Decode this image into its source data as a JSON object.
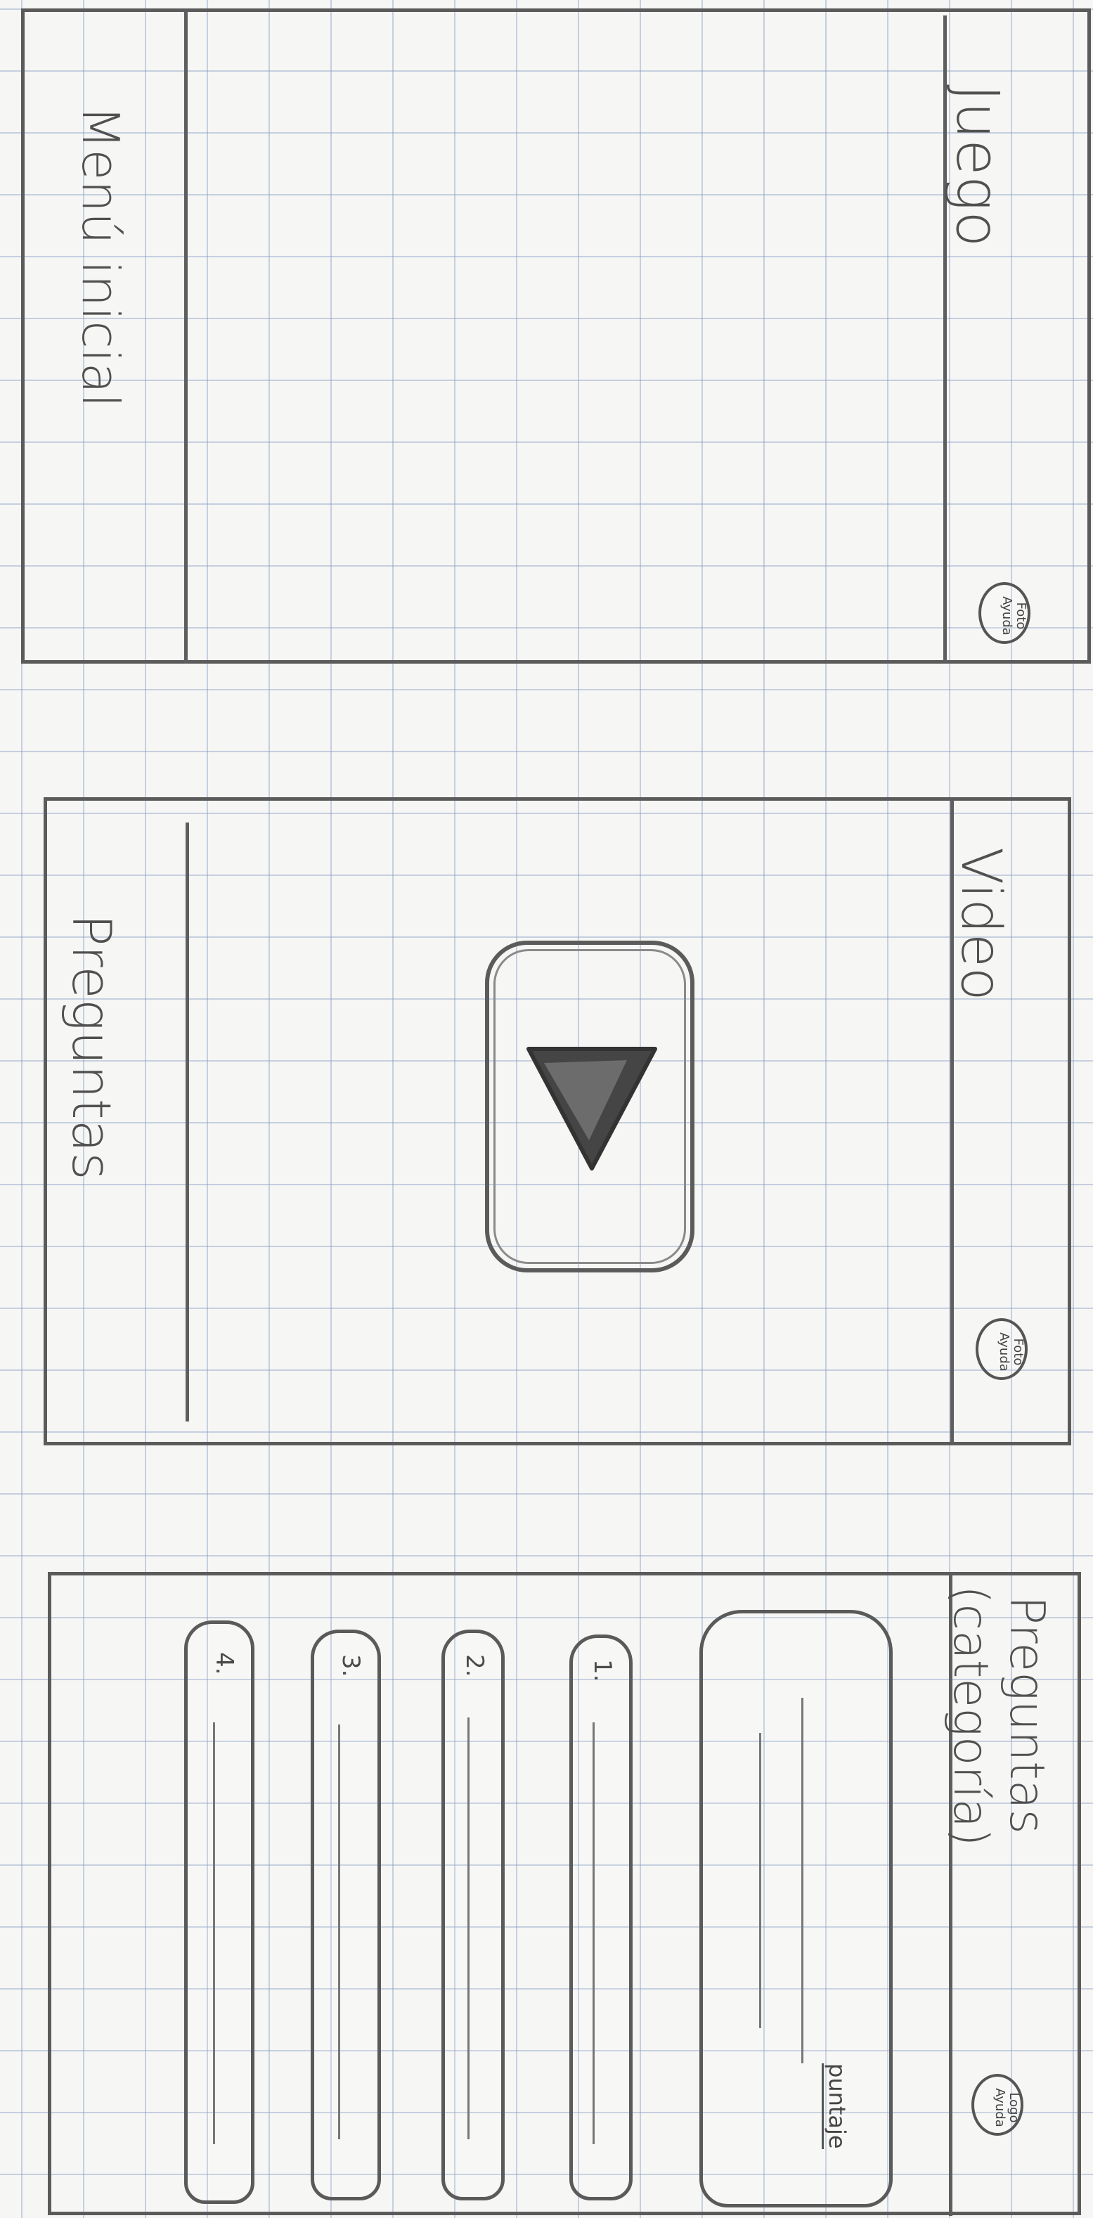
{
  "screens": [
    {
      "title": "Juego",
      "bottom_label": "Menú inicial",
      "corner_button": "Foto\nAyuda"
    },
    {
      "title": "Video",
      "bottom_label": "Preguntas",
      "corner_button": "Foto\nAyuda",
      "media": {
        "icon": "play-icon"
      }
    },
    {
      "title_line1": "Preguntas",
      "title_line2": "(categoría)",
      "corner_button": "Logo\nAyuda",
      "question_box": {
        "score_label": "puntaje"
      },
      "options": [
        "1.",
        "2.",
        "3.",
        "4."
      ]
    }
  ],
  "colors": {
    "pencil": "#555555",
    "paper": "#f6f6f4",
    "grid": "#7891be"
  }
}
